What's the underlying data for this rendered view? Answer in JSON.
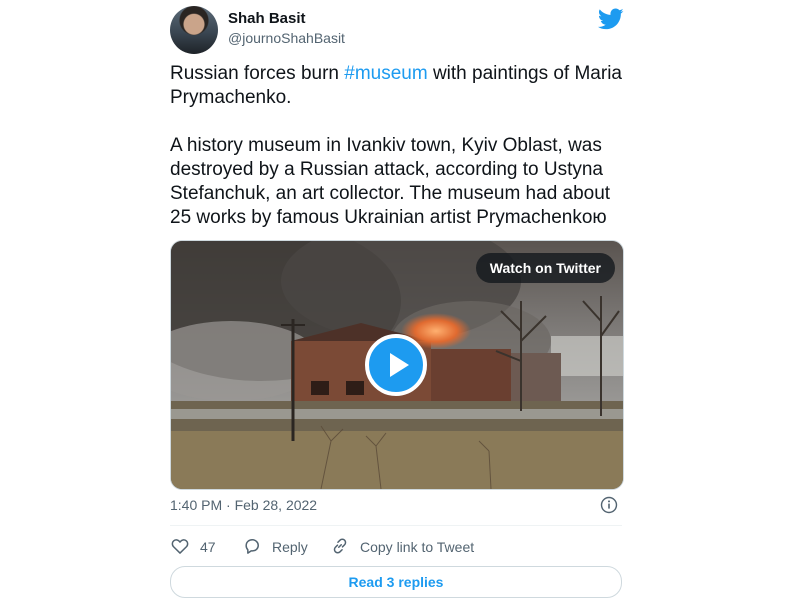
{
  "tweet": {
    "author": {
      "name": "Shah Basit",
      "handle": "@journoShahBasit"
    },
    "text": {
      "line1_before": "Russian forces burn ",
      "hashtag": "#museum",
      "line1_after": " with paintings of Maria Prymachenko.",
      "paragraph2": "A history museum in Ivankiv town, Kyiv Oblast, was destroyed by a Russian attack, according to Ustyna Stefanchuk, an art collector. The museum had about 25 works by famous Ukrainian artist Prymachenkoю"
    },
    "media": {
      "watch_label": "Watch on Twitter"
    },
    "timestamp": "1:40 PM · Feb 28, 2022",
    "actions": {
      "likes": "47",
      "reply_label": "Reply",
      "copy_label": "Copy link to Tweet"
    },
    "read_replies_label": "Read 3 replies",
    "colors": {
      "accent": "#1d9bf0",
      "text": "#0f1419",
      "secondary": "#536471"
    },
    "icons": [
      "twitter-bird-icon",
      "play-icon",
      "info-icon",
      "heart-icon",
      "reply-icon",
      "link-icon"
    ]
  }
}
